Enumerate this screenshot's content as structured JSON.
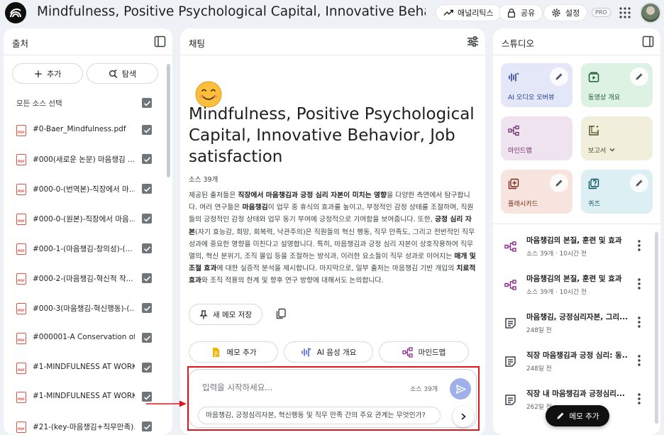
{
  "app": {
    "notebook_title": "Mindfulness, Positive Psychological Capital, Innovative Behavior, Job satisfaction",
    "analytics_label": "애널리틱스",
    "share_label": "공유",
    "settings_label": "설정",
    "pro_badge": "PRO"
  },
  "sources": {
    "header": "출처",
    "add_label": "추가",
    "explore_label": "탐색",
    "select_all_label": "모든 소스 선택",
    "items": [
      "#0-Baer_Mindfulness.pdf",
      "#000(새로운 논문) 마음챙김 ...",
      "#000-0-(번역본)-직장에서 마...",
      "#000-0-(원본)-직장에서 마음...",
      "#000-1-(마음챙김-창의성)-(...",
      "#000-2-(마음챙김-혁신적 작...",
      "#000-3(마음챙김-혁신행동)-(...",
      "#000001-A Conservation of...",
      "#1-MINDFULNESS AT WORK...",
      "#1-MINDFULNESS AT WORK...",
      "#21-(key-마음챙김+직무만족)..."
    ]
  },
  "chat": {
    "header": "채팅",
    "title": "Mindfulness, Positive Psychological Capital, Innovative Behavior, Job satisfaction",
    "source_count": "소스 39개",
    "summary": [
      {
        "t": "제공된 출처들은 "
      },
      {
        "t": "직장에서 마음챙김과 긍정 심리 자본이 미치는 영향",
        "b": true
      },
      {
        "t": "을 다양한 측면에서 탐구합니다. 여러 연구들은 "
      },
      {
        "t": "마음챙김",
        "b": true
      },
      {
        "t": "이 업무 중 휴식의 효과를 높이고, 부정적인 감정 상태를 조절하며, 직원들의 긍정적인 감정 상태와 업무 동기 부여에 긍정적으로 기여함을 보여줍니다. 또한, "
      },
      {
        "t": "긍정 심리 자본",
        "b": true
      },
      {
        "t": "(자기 효능감, 희망, 회복력, 낙관주의)은 직원들의 혁신 행동, 직무 만족도, 그리고 전반적인 직무 성과에 중요한 영향을 미친다고 설명합니다. 특히, 마음챙김과 긍정 심리 자본이 상호작용하여 직무 열의, 혁신 분위기, 조직 몰입 등을 조절하는 방식과, 이러한 요소들이 직무 성과로 이어지는 "
      },
      {
        "t": "매개 및 조절 효과",
        "b": true
      },
      {
        "t": "에 대한 실증적 분석을 제시합니다. 마지막으로, 일부 출처는 마음챙김 기반 개입의 "
      },
      {
        "t": "치료적 효과",
        "b": true
      },
      {
        "t": "와 조직 적용의 한계 및 향후 연구 방향에 대해서도 논의합니다."
      }
    ],
    "save_note_label": "새 메모 저장",
    "actions": [
      "메모 추가",
      "AI 음성 개요",
      "마인드맵"
    ],
    "input_placeholder": "입력을 시작하세요...",
    "input_source_count": "소스 39개",
    "suggestion": "마음챙김, 긍정심리자본, 혁신행동 및 직무 만족 간의 주요 관계는 무엇인가?"
  },
  "studio": {
    "header": "스튜디오",
    "cards": [
      {
        "label": "AI 오디오 오버뷰",
        "icon": "audio-wave-icon",
        "color": "#e3e7f8"
      },
      {
        "label": "동영상 개요",
        "icon": "video-icon",
        "color": "#def2e4"
      },
      {
        "label": "마인드맵",
        "icon": "mindmap-icon",
        "color": "#efe3ef"
      },
      {
        "label": "보고서",
        "icon": "report-icon",
        "color": "#f1efdc"
      },
      {
        "label": "플래시카드",
        "icon": "flashcard-icon",
        "color": "#f8e4df"
      },
      {
        "label": "퀴즈",
        "icon": "quiz-icon",
        "color": "#dcf0f3"
      }
    ],
    "notes": [
      {
        "title": "마음챙김의 본질, 훈련 및 효과",
        "sub": "소스 39개 · 10시간 전",
        "icon": "mindmap-icon"
      },
      {
        "title": "마음챙김의 본질, 훈련 및 효과",
        "sub": "소스 39개 · 10시간 전",
        "icon": "mindmap-icon"
      },
      {
        "title": "마음챙김, 긍정심리자본, 그리...",
        "sub": "248일 전",
        "icon": "note-icon"
      },
      {
        "title": "직장 마음챙김과 긍정 심리: 동...",
        "sub": "248일 전",
        "icon": "note-icon"
      },
      {
        "title": "직장 내 마음챙김과 긍정심리...",
        "sub": "262일 전",
        "icon": "note-icon"
      }
    ],
    "add_note_label": "메모 추가"
  }
}
